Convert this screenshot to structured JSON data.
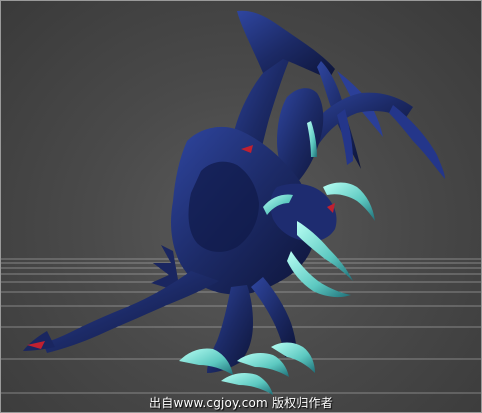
{
  "viewport": {
    "name": "3D perspective viewport",
    "background_color": "#4a4a4a",
    "grid_color": "#bdbdbd",
    "model_colors": {
      "body": "#1c2a66",
      "body_dark": "#0d1438",
      "highlight": "#3e58b8",
      "claw": "#7fe0d8",
      "accent": "#c02030"
    }
  },
  "watermark": {
    "text": "出自www.cgjoy.com 版权归作者"
  }
}
